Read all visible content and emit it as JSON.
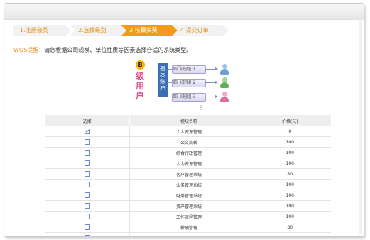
{
  "steps": [
    {
      "label": "1.注册会员",
      "active": false
    },
    {
      "label": "2.选择级别",
      "active": false
    },
    {
      "label": "3.核算资费",
      "active": true
    },
    {
      "label": "4.提交订单",
      "active": false
    }
  ],
  "tip": {
    "label": "WOS提醒：",
    "text": "请您根据公司规模、单位性质等因素选择合适的系统类型。"
  },
  "diagram": {
    "badge": "B",
    "level_text": "级用户",
    "account_text": "基本账户",
    "departments": [
      "部门(班组)1",
      "部门(班组)2",
      "部门(班组)3"
    ],
    "dots": "⋮"
  },
  "table": {
    "headers": [
      "选择",
      "模块名称",
      "价格(元)"
    ],
    "rows": [
      {
        "checked": true,
        "name": "个人资源管理",
        "price": "0"
      },
      {
        "checked": false,
        "name": "公文流转",
        "price": "100"
      },
      {
        "checked": false,
        "name": "综合行政管理",
        "price": "100"
      },
      {
        "checked": false,
        "name": "人力资源管理",
        "price": "100"
      },
      {
        "checked": false,
        "name": "客户管理系统",
        "price": "80"
      },
      {
        "checked": false,
        "name": "业务管理系统",
        "price": "100"
      },
      {
        "checked": false,
        "name": "财务管理系统",
        "price": "100"
      },
      {
        "checked": false,
        "name": "资产管理系统",
        "price": "100"
      },
      {
        "checked": false,
        "name": "工作流程管理",
        "price": "100"
      },
      {
        "checked": false,
        "name": "薪酬管理",
        "price": "80"
      },
      {
        "checked": false,
        "name": "考勤管理",
        "price": "60"
      }
    ]
  },
  "colors": {
    "accent": "#f39a1a",
    "tip_label": "#e8901e",
    "level": "#e14d8a",
    "account": "#3d6fb4"
  }
}
